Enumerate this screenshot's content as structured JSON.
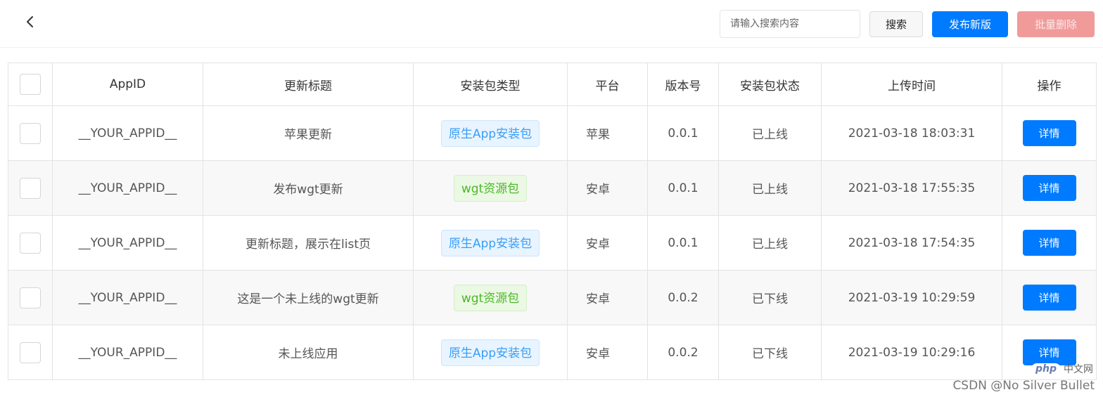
{
  "toolbar": {
    "back_icon": "chevron-left-icon",
    "search_placeholder": "请输入搜索内容",
    "search_value": "",
    "search_label": "搜索",
    "publish_label": "发布新版",
    "batch_delete_label": "批量删除"
  },
  "table": {
    "headers": {
      "appid": "AppID",
      "title": "更新标题",
      "pkg_type": "安装包类型",
      "platform": "平台",
      "version": "版本号",
      "status": "安装包状态",
      "upload_time": "上传时间",
      "actions": "操作"
    },
    "rows": [
      {
        "appid": "__YOUR_APPID__",
        "title": "苹果更新",
        "pkg_type": "原生App安装包",
        "pkg_kind": "native",
        "platform": "苹果",
        "version": "0.0.1",
        "status": "已上线",
        "upload_time": "2021-03-18 18:03:31",
        "action": "详情"
      },
      {
        "appid": "__YOUR_APPID__",
        "title": "发布wgt更新",
        "pkg_type": "wgt资源包",
        "pkg_kind": "wgt",
        "platform": "安卓",
        "version": "0.0.1",
        "status": "已上线",
        "upload_time": "2021-03-18 17:55:35",
        "action": "详情"
      },
      {
        "appid": "__YOUR_APPID__",
        "title": "更新标题，展示在list页",
        "pkg_type": "原生App安装包",
        "pkg_kind": "native",
        "platform": "安卓",
        "version": "0.0.1",
        "status": "已上线",
        "upload_time": "2021-03-18 17:54:35",
        "action": "详情"
      },
      {
        "appid": "__YOUR_APPID__",
        "title": "这是一个未上线的wgt更新",
        "pkg_type": "wgt资源包",
        "pkg_kind": "wgt",
        "platform": "安卓",
        "version": "0.0.2",
        "status": "已下线",
        "upload_time": "2021-03-19 10:29:59",
        "action": "详情"
      },
      {
        "appid": "__YOUR_APPID__",
        "title": "未上线应用",
        "pkg_type": "原生App安装包",
        "pkg_kind": "native",
        "platform": "安卓",
        "version": "0.0.2",
        "status": "已下线",
        "upload_time": "2021-03-19 10:29:16",
        "action": "详情"
      }
    ]
  },
  "colors": {
    "primary": "#007aff",
    "danger_disabled": "#f09a9a",
    "tag_native_text": "#3a9ef5",
    "tag_wgt_text": "#4cb829"
  },
  "watermark": {
    "logo": "php",
    "site": "中文网",
    "text": "CSDN @No Silver Bullet"
  }
}
